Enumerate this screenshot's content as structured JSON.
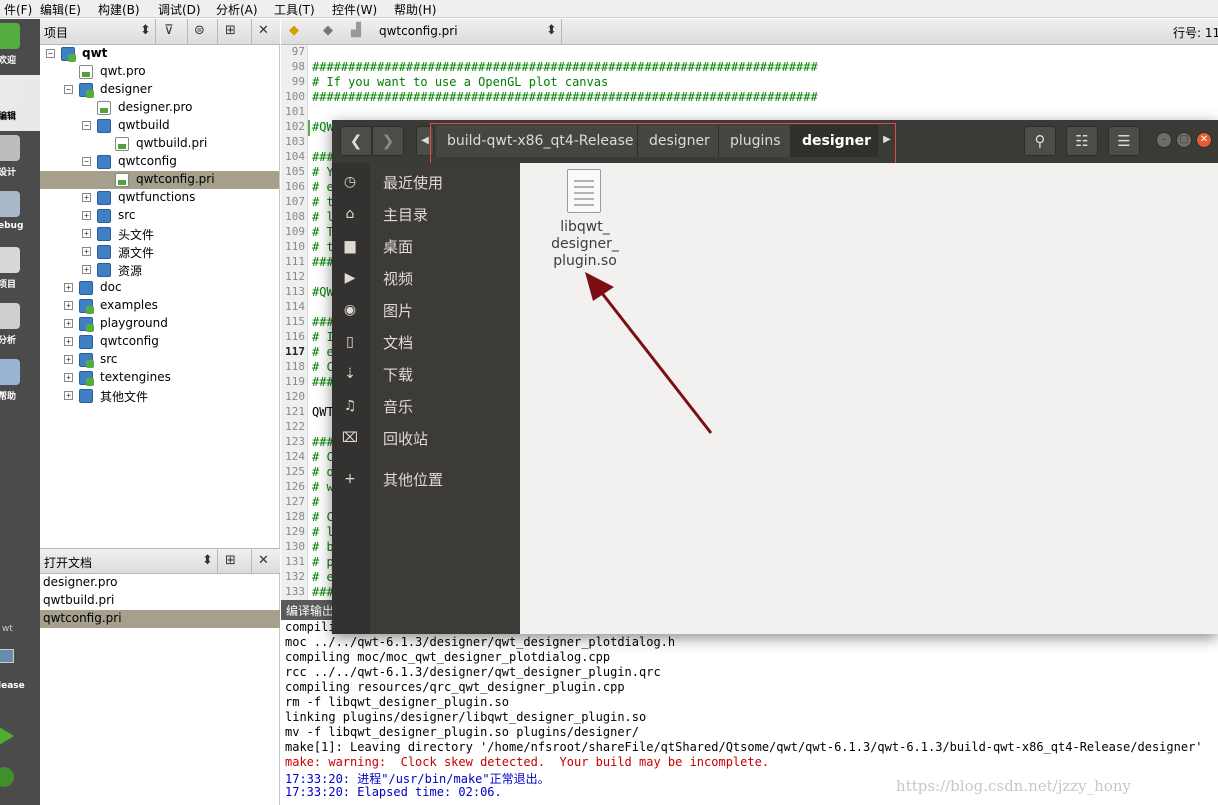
{
  "menubar": {
    "items": [
      "件(F)",
      "编辑(E)",
      "构建(B)",
      "调试(D)",
      "分析(A)",
      "工具(T)",
      "控件(W)",
      "帮助(H)"
    ]
  },
  "modebar": {
    "modes": [
      {
        "label": "欢迎",
        "icon": "qt-logo-icon"
      },
      {
        "label": "编辑",
        "icon": "edit-icon",
        "active": true
      },
      {
        "label": "设计",
        "icon": "design-icon"
      },
      {
        "label": "ebug",
        "icon": "debug-icon"
      },
      {
        "label": "项目",
        "icon": "projects-icon"
      },
      {
        "label": "分析",
        "icon": "analyze-icon"
      },
      {
        "label": "帮助",
        "icon": "help-icon"
      }
    ],
    "target_name": "wt",
    "target_mode": "lease"
  },
  "project_panel": {
    "title": "项目",
    "tree": [
      {
        "label": "qwt",
        "depth": 0,
        "expander": "-",
        "type": "proj",
        "bold": true
      },
      {
        "label": "qwt.pro",
        "depth": 1,
        "type": "file"
      },
      {
        "label": "designer",
        "depth": 1,
        "expander": "-",
        "type": "proj"
      },
      {
        "label": "designer.pro",
        "depth": 2,
        "type": "file"
      },
      {
        "label": "qwtbuild",
        "depth": 2,
        "expander": "-",
        "type": "folder"
      },
      {
        "label": "qwtbuild.pri",
        "depth": 3,
        "type": "file"
      },
      {
        "label": "qwtconfig",
        "depth": 2,
        "expander": "-",
        "type": "folder"
      },
      {
        "label": "qwtconfig.pri",
        "depth": 3,
        "type": "file",
        "selected": true
      },
      {
        "label": "qwtfunctions",
        "depth": 2,
        "expander": "+",
        "type": "folder"
      },
      {
        "label": "src",
        "depth": 2,
        "expander": "+",
        "type": "folder"
      },
      {
        "label": "头文件",
        "depth": 2,
        "expander": "+",
        "type": "folder"
      },
      {
        "label": "源文件",
        "depth": 2,
        "expander": "+",
        "type": "folder"
      },
      {
        "label": "资源",
        "depth": 2,
        "expander": "+",
        "type": "folder"
      },
      {
        "label": "doc",
        "depth": 1,
        "expander": "+",
        "type": "folder"
      },
      {
        "label": "examples",
        "depth": 1,
        "expander": "+",
        "type": "proj"
      },
      {
        "label": "playground",
        "depth": 1,
        "expander": "+",
        "type": "proj"
      },
      {
        "label": "qwtconfig",
        "depth": 1,
        "expander": "+",
        "type": "folder"
      },
      {
        "label": "src",
        "depth": 1,
        "expander": "+",
        "type": "proj"
      },
      {
        "label": "textengines",
        "depth": 1,
        "expander": "+",
        "type": "proj"
      },
      {
        "label": "其他文件",
        "depth": 1,
        "expander": "+",
        "type": "folder"
      }
    ]
  },
  "open_docs": {
    "title": "打开文档",
    "items": [
      "designer.pro",
      "qwtbuild.pri",
      "qwtconfig.pri"
    ],
    "selected_index": 2
  },
  "editor": {
    "filename": "qwtconfig.pri",
    "line_label": "行号: 11",
    "lines": [
      {
        "n": "97",
        "text": ""
      },
      {
        "n": "98",
        "text": "######################################################################"
      },
      {
        "n": "99",
        "text": "# If you want to use a OpenGL plot canvas"
      },
      {
        "n": "100",
        "text": "######################################################################"
      },
      {
        "n": "101",
        "text": ""
      },
      {
        "n": "102",
        "text": "#QW",
        "mark": true
      },
      {
        "n": "103",
        "text": ""
      },
      {
        "n": "104",
        "text": "###"
      },
      {
        "n": "105",
        "text": "# Y"
      },
      {
        "n": "106",
        "text": "# e"
      },
      {
        "n": "107",
        "text": "# t"
      },
      {
        "n": "108",
        "text": "# l"
      },
      {
        "n": "109",
        "text": "# T"
      },
      {
        "n": "110",
        "text": "# t"
      },
      {
        "n": "111",
        "text": "###"
      },
      {
        "n": "112",
        "text": ""
      },
      {
        "n": "113",
        "text": "#QW"
      },
      {
        "n": "114",
        "text": ""
      },
      {
        "n": "115",
        "text": "###"
      },
      {
        "n": "116",
        "text": "# I"
      },
      {
        "n": "117",
        "text": "# e",
        "current": true
      },
      {
        "n": "118",
        "text": "# C"
      },
      {
        "n": "119",
        "text": "###"
      },
      {
        "n": "120",
        "text": ""
      },
      {
        "n": "121",
        "text": "QWT",
        "plain": true
      },
      {
        "n": "122",
        "text": ""
      },
      {
        "n": "123",
        "text": "###"
      },
      {
        "n": "124",
        "text": "# C"
      },
      {
        "n": "125",
        "text": "# o"
      },
      {
        "n": "126",
        "text": "# w"
      },
      {
        "n": "127",
        "text": "#"
      },
      {
        "n": "128",
        "text": "# C"
      },
      {
        "n": "129",
        "text": "# l"
      },
      {
        "n": "130",
        "text": "# b"
      },
      {
        "n": "131",
        "text": "# p"
      },
      {
        "n": "132",
        "text": "# e"
      },
      {
        "n": "133",
        "text": "###"
      }
    ]
  },
  "output": {
    "title": "编译输出",
    "lines": [
      {
        "text": "compiling moc/qwt_designer_plotdialog.cpp",
        "kind": "plain"
      },
      {
        "text": "moc ../../qwt-6.1.3/designer/qwt_designer_plotdialog.h",
        "kind": "plain"
      },
      {
        "text": "compiling moc/moc_qwt_designer_plotdialog.cpp",
        "kind": "plain"
      },
      {
        "text": "rcc ../../qwt-6.1.3/designer/qwt_designer_plugin.qrc",
        "kind": "plain"
      },
      {
        "text": "compiling resources/qrc_qwt_designer_plugin.cpp",
        "kind": "plain"
      },
      {
        "text": "rm -f libqwt_designer_plugin.so",
        "kind": "plain"
      },
      {
        "text": "linking plugins/designer/libqwt_designer_plugin.so",
        "kind": "plain"
      },
      {
        "text": "mv -f libqwt_designer_plugin.so plugins/designer/",
        "kind": "plain"
      },
      {
        "text": "make[1]: Leaving directory '/home/nfsroot/shareFile/qtShared/Qtsome/qwt/qwt-6.1.3/qwt-6.1.3/build-qwt-x86_qt4-Release/designer'",
        "kind": "plain"
      },
      {
        "text": "make: warning:  Clock skew detected.  Your build may be incomplete.",
        "kind": "warn"
      },
      {
        "text": "17:33:20: 进程\"/usr/bin/make\"正常退出。",
        "kind": "blue"
      },
      {
        "text": "17:33:20: Elapsed time: 02:06.",
        "kind": "blue"
      }
    ],
    "watermark": "https://blog.csdn.net/jzzy_hony"
  },
  "file_manager": {
    "breadcrumbs": [
      "build-qwt-x86_qt4-Release",
      "designer",
      "plugins",
      "designer"
    ],
    "current_index": 3,
    "places": [
      {
        "label": "最近使用",
        "icon": "clock-icon",
        "glyph": "◷"
      },
      {
        "label": "主目录",
        "icon": "home-icon",
        "glyph": "⌂"
      },
      {
        "label": "桌面",
        "icon": "desktop-folder-icon",
        "glyph": "▆"
      },
      {
        "label": "视频",
        "icon": "video-icon",
        "glyph": "▶"
      },
      {
        "label": "图片",
        "icon": "camera-icon",
        "glyph": "◉"
      },
      {
        "label": "文档",
        "icon": "document-icon",
        "glyph": "▯"
      },
      {
        "label": "下载",
        "icon": "download-icon",
        "glyph": "⇣"
      },
      {
        "label": "音乐",
        "icon": "music-icon",
        "glyph": "♫"
      },
      {
        "label": "回收站",
        "icon": "trash-icon",
        "glyph": "⌧"
      },
      {
        "label": "其他位置",
        "icon": "plus-icon",
        "glyph": "+"
      }
    ],
    "file_name": "libqwt_\ndesigner_\nplugin.so",
    "colors": {
      "accent_red": "#e24a4a",
      "arrow": "#7b0f14",
      "header": "#3a3a37",
      "sidebar": "#3c3b37"
    }
  }
}
